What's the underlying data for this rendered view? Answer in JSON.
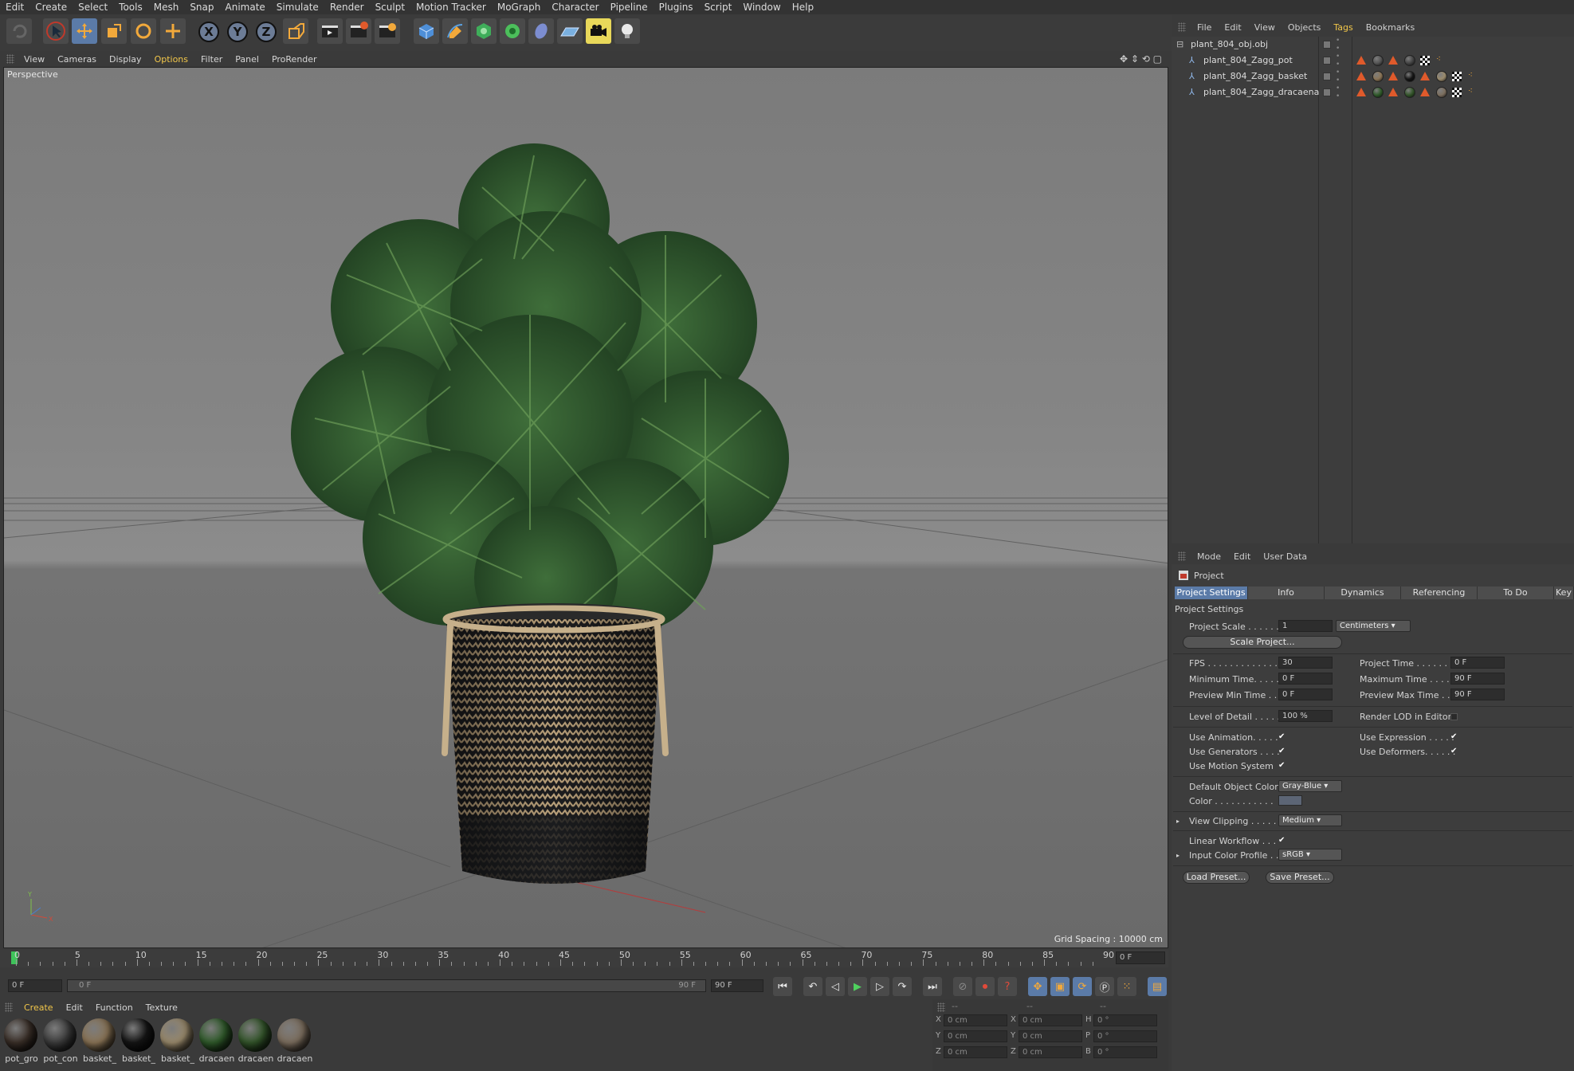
{
  "menubar": [
    "Edit",
    "Create",
    "Select",
    "Tools",
    "Mesh",
    "Snap",
    "Animate",
    "Simulate",
    "Render",
    "Sculpt",
    "Motion Tracker",
    "MoGraph",
    "Character",
    "Pipeline",
    "Plugins",
    "Script",
    "Window",
    "Help"
  ],
  "toolbar": {
    "axis_x": "X",
    "axis_y": "Y",
    "axis_z": "Z"
  },
  "viewport": {
    "menu": [
      "View",
      "Cameras",
      "Display",
      "Options",
      "Filter",
      "Panel",
      "ProRender"
    ],
    "label": "Perspective",
    "grid_spacing": "Grid Spacing : 10000 cm"
  },
  "timeline": {
    "ticks": [
      "0",
      "5",
      "10",
      "15",
      "20",
      "25",
      "30",
      "35",
      "40",
      "45",
      "50",
      "55",
      "60",
      "65",
      "70",
      "75",
      "80",
      "85",
      "90"
    ],
    "current_frame_right": "0 F",
    "start_field": "0 F",
    "slider_start": "0 F",
    "slider_end": "90 F",
    "end_field": "90 F"
  },
  "materials": {
    "menu": [
      "Create",
      "Edit",
      "Function",
      "Texture"
    ],
    "items": [
      {
        "label": "pot_gro",
        "color": "#3a2f28"
      },
      {
        "label": "pot_con",
        "color": "#3c3c3c"
      },
      {
        "label": "basket_",
        "color": "#8a7456"
      },
      {
        "label": "basket_",
        "color": "#151515"
      },
      {
        "label": "basket_",
        "color": "#9a8a6c"
      },
      {
        "label": "dracaen",
        "color": "#2f5a2a"
      },
      {
        "label": "dracaen",
        "color": "#33552a"
      },
      {
        "label": "dracaen",
        "color": "#7c6e5e"
      }
    ]
  },
  "coords": {
    "headers": [
      "--",
      "--",
      "--"
    ],
    "rows": [
      {
        "a": "X",
        "av": "0 cm",
        "b": "X",
        "bv": "0 cm",
        "c": "H",
        "cv": "0 °"
      },
      {
        "a": "Y",
        "av": "0 cm",
        "b": "Y",
        "bv": "0 cm",
        "c": "P",
        "cv": "0 °"
      },
      {
        "a": "Z",
        "av": "0 cm",
        "b": "Z",
        "bv": "0 cm",
        "c": "B",
        "cv": "0 °"
      }
    ]
  },
  "object_manager": {
    "menu": [
      "File",
      "Edit",
      "View",
      "Objects",
      "Tags",
      "Bookmarks"
    ],
    "objects": [
      {
        "name": "plant_804_obj.obj"
      },
      {
        "name": "plant_804_Zagg_pot"
      },
      {
        "name": "plant_804_Zagg_basket"
      },
      {
        "name": "plant_804_Zagg_dracaena"
      }
    ]
  },
  "attribute_manager": {
    "menu": [
      "Mode",
      "Edit",
      "User Data"
    ],
    "title": "Project",
    "tabs": [
      "Project Settings",
      "Info",
      "Dynamics",
      "Referencing",
      "To Do",
      "Key"
    ],
    "section": "Project Settings",
    "project_scale_label": "Project Scale . . . . . .",
    "project_scale_value": "1",
    "project_scale_unit": "Centimeters",
    "scale_project_btn": "Scale Project...",
    "fps_label": "FPS . . . . . . . . . . . . . . .",
    "fps_value": "30",
    "project_time_label": "Project Time . . . . . . . .",
    "project_time_value": "0 F",
    "min_time_label": "Minimum Time. . . . .",
    "min_time_value": "0 F",
    "max_time_label": "Maximum Time . . . . .",
    "max_time_value": "90 F",
    "prev_min_label": "Preview Min Time . .",
    "prev_min_value": "0 F",
    "prev_max_label": "Preview Max Time . . .",
    "prev_max_value": "90 F",
    "lod_label": "Level of Detail . . . . .",
    "lod_value": "100 %",
    "render_lod_label": "Render LOD in Editor",
    "use_animation_label": "Use Animation. . . . .",
    "use_expression_label": "Use Expression . . . . .",
    "use_generators_label": "Use Generators . . . .",
    "use_deformers_label": "Use Deformers. . . . . .",
    "use_motion_label": "Use Motion System",
    "default_color_label": "Default Object Color",
    "default_color_value": "Gray-Blue",
    "color_label": "Color . . . . . . . . . . .",
    "view_clipping_label": "View Clipping . . . . .",
    "view_clipping_value": "Medium",
    "linear_workflow_label": "Linear Workflow . . .",
    "input_profile_label": "Input Color Profile . .",
    "input_profile_value": "sRGB",
    "load_preset": "Load Preset...",
    "save_preset": "Save Preset..."
  }
}
